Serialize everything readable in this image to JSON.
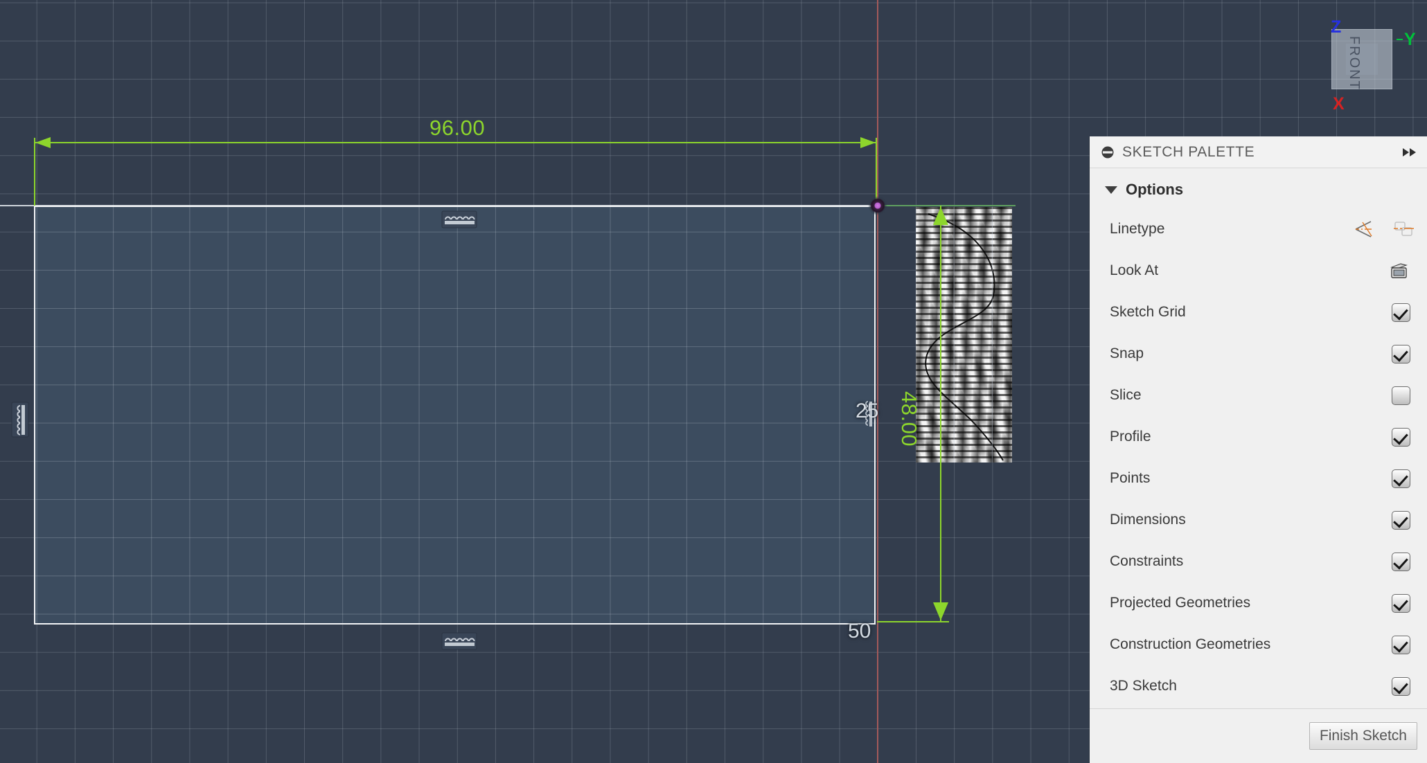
{
  "canvas": {
    "background_color": "#333d4d",
    "profile_fill_color": "#3c4c5f",
    "sketch_line_color": "#f2f4f6",
    "dimension_color": "#8dd62c",
    "origin_color": "#b85ccf",
    "x_axis_color": "#a35a5a",
    "y_axis_color": "#5fa05f",
    "dimensions": {
      "horizontal": "96.00",
      "vertical": "48.00"
    },
    "labels": {
      "value_25": "25",
      "value_50": "50"
    },
    "icons": {
      "horizontal_constraint_top": "horizontal-constraint-icon",
      "horizontal_constraint_bottom": "horizontal-constraint-icon",
      "vertical_constraint_left": "vertical-constraint-icon",
      "vertical_constraint_right": "vertical-constraint-icon",
      "origin": "origin-point-icon"
    }
  },
  "viewcube": {
    "face_label": "FRONT",
    "axes": {
      "z": "Z",
      "y": "Y",
      "x": "X"
    },
    "axis_colors": {
      "z": "#2530e0",
      "y": "#00c23a",
      "x": "#d62222"
    }
  },
  "palette": {
    "title": "SKETCH PALETTE",
    "header_icon": "minimize-icon",
    "expand_icon": "expand-right-icon",
    "group": {
      "label": "Options",
      "caret_icon": "caret-down-icon",
      "expanded": true
    },
    "options": [
      {
        "label": "Linetype",
        "type": "icons",
        "icons": [
          "centerline-icon",
          "construction-region-icon"
        ]
      },
      {
        "label": "Look At",
        "type": "icons",
        "icons": [
          "look-at-icon"
        ]
      },
      {
        "label": "Sketch Grid",
        "type": "checkbox",
        "checked": true
      },
      {
        "label": "Snap",
        "type": "checkbox",
        "checked": true
      },
      {
        "label": "Slice",
        "type": "checkbox",
        "checked": false
      },
      {
        "label": "Profile",
        "type": "checkbox",
        "checked": true
      },
      {
        "label": "Points",
        "type": "checkbox",
        "checked": true
      },
      {
        "label": "Dimensions",
        "type": "checkbox",
        "checked": true
      },
      {
        "label": "Constraints",
        "type": "checkbox",
        "checked": true
      },
      {
        "label": "Projected Geometries",
        "type": "checkbox",
        "checked": true
      },
      {
        "label": "Construction Geometries",
        "type": "checkbox",
        "checked": true
      },
      {
        "label": "3D Sketch",
        "type": "checkbox",
        "checked": true
      }
    ],
    "footer": {
      "finish_sketch_label": "Finish Sketch"
    }
  }
}
